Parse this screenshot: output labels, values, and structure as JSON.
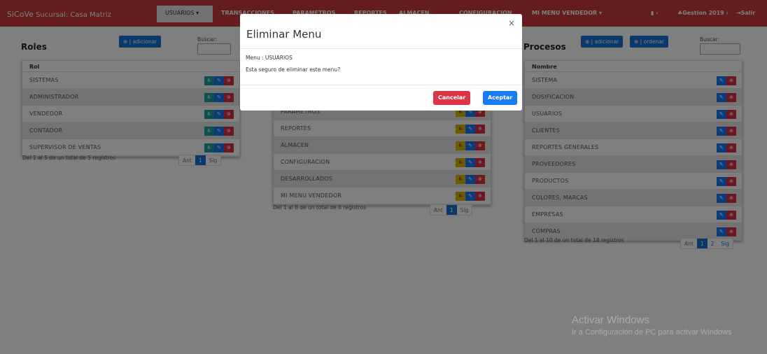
{
  "navbar": {
    "brand_main": "SiCoVe",
    "brand_sub": "Sucursal: Casa Matriz",
    "items": [
      "USUARIOS ▾",
      "TRANSACCIONES",
      "PARAMETROS",
      "REPORTES",
      "ALMACEN",
      "CONFIGURACION",
      "MI MENU VENDEDOR ▾"
    ],
    "user_icon": "user-icon",
    "gestion": "Gestion 2019",
    "salir": "Salir",
    "chevron": "›"
  },
  "roles": {
    "title": "Roles",
    "add_label": "⊕ | adicionar",
    "search_label": "Buscar:",
    "search_value": "",
    "column": "Rol",
    "rows": [
      "SISTEMAS",
      "ADMINISTRADOR",
      "VENDEDOR",
      "CONTADOR",
      "SUPERVISOR DE VENTAS"
    ],
    "footer": "Del 1 al 5 de un total de 5 registros",
    "pager": {
      "prev": "Ant",
      "page": "1",
      "next": "Sig"
    }
  },
  "menus": {
    "rows": [
      "PARAMETROS",
      "REPORTES",
      "ALMACEN",
      "CONFIGURACION",
      "DESARROLLADOS",
      "MI MENU VENDEDOR"
    ],
    "footer": "Del 1 al 8 de un total de 8 registros",
    "pager": {
      "prev": "Ant",
      "page": "1",
      "next": "Sig"
    }
  },
  "procesos": {
    "title": "Procesos",
    "add_label": "⊕ | adicionar",
    "order_label": "⊕ | ordenar",
    "search_label": "Buscar:",
    "search_value": "",
    "column": "Nombre",
    "rows": [
      "SISTEMA",
      "DOSIFICACION",
      "USUARIOS",
      "CLIENTES",
      "REPORTES GENERALES",
      "PROVEEDORES",
      "PRODUCTOS",
      "COLORES, MARCAS",
      "EMPRESAS",
      "COMPRAS"
    ],
    "footer": "Del 1 al 10 de un total de 18 registros",
    "pager": {
      "prev": "Ant",
      "page": "1",
      "page2": "2",
      "next": "Sig"
    }
  },
  "icons": {
    "menu": "₺",
    "edit": "✎",
    "delete": "⊗"
  },
  "modal": {
    "title": "Eliminar Menu",
    "close": "×",
    "line1": "Menu : USUARIOS",
    "line2": "Esta seguro de eliminar este menu?",
    "cancel": "Cancelar",
    "accept": "Aceptar"
  },
  "watermark": {
    "title": "Activar Windows",
    "subtitle": "Ir a Configuración de PC para activar Windows"
  },
  "colors": {
    "navbar": "#c9393d",
    "primary": "#1571d4",
    "danger": "#dc3545",
    "teal": "#19a0a0",
    "yellow": "#e0b400"
  }
}
